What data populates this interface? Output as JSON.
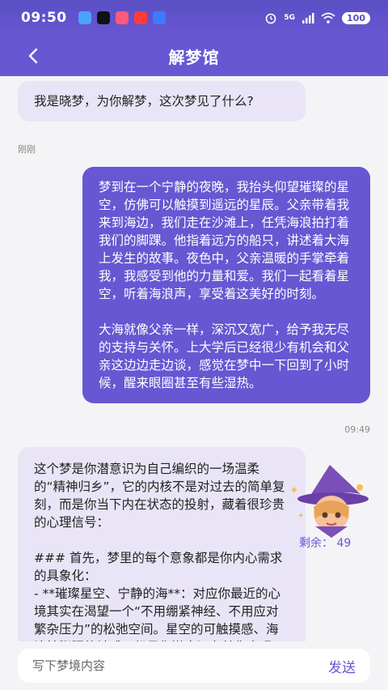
{
  "status_bar": {
    "time": "09:50",
    "network": "5G",
    "battery": "100",
    "notification_icons": [
      {
        "name": "message-app-icon",
        "color": "#4aa3ff"
      },
      {
        "name": "tiktok-icon",
        "color": "#111111"
      },
      {
        "name": "app-badge-icon",
        "color": "#ff5a7a"
      },
      {
        "name": "red-app-icon",
        "color": "#ff3b3b"
      },
      {
        "name": "blue-app-icon",
        "color": "#3b7bff"
      }
    ]
  },
  "navbar": {
    "title": "解梦馆"
  },
  "chat": {
    "bot_greeting": "我是晓梦，为你解梦，这次梦见了什么?",
    "greeting_time": "刚刚",
    "user_message": {
      "paragraphs": [
        "梦到在一个宁静的夜晚，我抬头仰望璀璨的星空，仿佛可以触摸到遥远的星辰。父亲带着我来到海边，我们走在沙滩上，任凭海浪拍打着我们的脚踝。他指着远方的船只，讲述着大海上发生的故事。夜色中，父亲温暖的手掌牵着我，我感受到他的力量和爱。我们一起看着星空，听着海浪声，享受着这美好的时刻。",
        "大海就像父亲一样，深沉又宽广，给予我无尽的支持与关怀。上大学后已经很少有机会和父亲这边边走边谈，感觉在梦中一下回到了小时候，醒来眼圈甚至有些湿热。"
      ],
      "time": "09:49"
    },
    "bot_reply": {
      "lines": [
        "这个梦是你潜意识为自己编织的一场温柔的“精神归乡”，它的内核不是对过去的简单复刻，而是你当下内在状态的投射，藏着很珍贵的心理信号：",
        "",
        "### 首先，梦里的每个意象都是你内心需求的具象化：",
        "- **璀璨星空、宁静的海**：对应你最近的心境其实在渴望一个“不用绷紧神经、不用应对繁杂压力”的松弛空间。星空的可触摸感、海浪拍脚踝的触感，都是你潜意识在替你实现"
      ]
    },
    "remaining_label": "剩余：",
    "remaining_count": "49"
  },
  "input": {
    "placeholder": "写下梦境内容",
    "value": "",
    "send_label": "发送"
  },
  "colors": {
    "accent": "#6757d2",
    "bot_bubble": "#e9e5f7",
    "background": "#f4f4f6"
  }
}
